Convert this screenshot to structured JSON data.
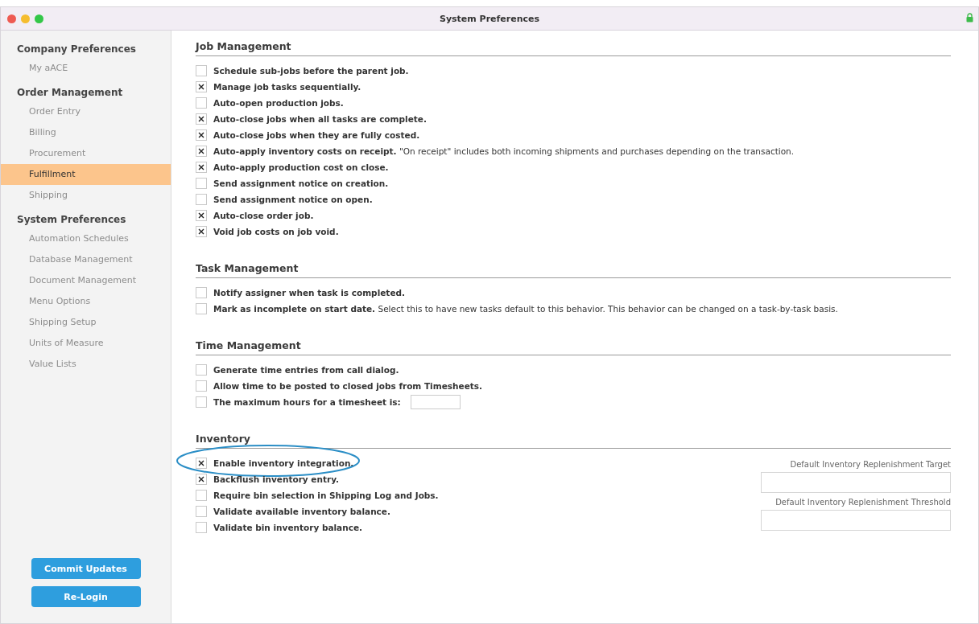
{
  "window": {
    "title": "System Preferences"
  },
  "sidebar": {
    "groups": [
      {
        "heading": "Company Preferences",
        "items": [
          {
            "label": "My aACE",
            "selected": false
          }
        ]
      },
      {
        "heading": "Order Management",
        "items": [
          {
            "label": "Order Entry",
            "selected": false
          },
          {
            "label": "Billing",
            "selected": false
          },
          {
            "label": "Procurement",
            "selected": false
          },
          {
            "label": "Fulfillment",
            "selected": true
          },
          {
            "label": "Shipping",
            "selected": false
          }
        ]
      },
      {
        "heading": "System Preferences",
        "items": [
          {
            "label": "Automation Schedules",
            "selected": false
          },
          {
            "label": "Database Management",
            "selected": false
          },
          {
            "label": "Document Management",
            "selected": false
          },
          {
            "label": "Menu Options",
            "selected": false
          },
          {
            "label": "Shipping Setup",
            "selected": false
          },
          {
            "label": "Units of Measure",
            "selected": false
          },
          {
            "label": "Value Lists",
            "selected": false
          }
        ]
      }
    ],
    "buttons": [
      "Commit Updates",
      "Re-Login"
    ]
  },
  "sections": [
    {
      "title": "Job Management",
      "items": [
        {
          "kind": "checkbox",
          "label": "Schedule sub-jobs before the parent job.",
          "checked": false
        },
        {
          "kind": "checkbox",
          "label": "Manage job tasks sequentially.",
          "checked": true
        },
        {
          "kind": "checkbox",
          "label": "Auto-open production jobs.",
          "checked": false
        },
        {
          "kind": "checkbox",
          "label": "Auto-close jobs when all tasks are complete.",
          "checked": true
        },
        {
          "kind": "checkbox",
          "label": "Auto-close jobs when they are fully costed.",
          "checked": true
        },
        {
          "kind": "checkbox",
          "label": "Auto-apply inventory costs on receipt.",
          "note": "\"On receipt\" includes both incoming shipments and purchases depending on the transaction.",
          "checked": true
        },
        {
          "kind": "checkbox",
          "label": "Auto-apply production cost on close.",
          "checked": true
        },
        {
          "kind": "checkbox",
          "label": "Send assignment notice on creation.",
          "checked": false
        },
        {
          "kind": "checkbox",
          "label": "Send assignment notice on open.",
          "checked": false
        },
        {
          "kind": "checkbox",
          "label": "Auto-close order job.",
          "checked": true
        },
        {
          "kind": "checkbox",
          "label": "Void job costs on job void.",
          "checked": true
        }
      ]
    },
    {
      "title": "Task Management",
      "items": [
        {
          "kind": "checkbox",
          "label": "Notify assigner when task is completed.",
          "checked": false
        },
        {
          "kind": "checkbox",
          "label": "Mark as incomplete on start date.",
          "note": "Select this to have new tasks default to this behavior. This behavior can be changed on a task-by-task basis.",
          "checked": false
        }
      ]
    },
    {
      "title": "Time Management",
      "items": [
        {
          "kind": "checkbox",
          "label": "Generate time entries from call dialog.",
          "checked": false
        },
        {
          "kind": "checkbox",
          "label": "Allow time to be posted to closed jobs from Timesheets.",
          "checked": false
        },
        {
          "kind": "checkbox_input",
          "label": "The maximum hours for a timesheet is:",
          "checked": false
        }
      ]
    },
    {
      "title": "Inventory",
      "items": [
        {
          "kind": "checkbox",
          "label": "Enable inventory integration.",
          "checked": true,
          "highlighted": true
        },
        {
          "kind": "checkbox",
          "label": "Backflush inventory entry.",
          "checked": true
        },
        {
          "kind": "checkbox",
          "label": "Require bin selection in Shipping Log and Jobs.",
          "checked": false
        },
        {
          "kind": "checkbox",
          "label": "Validate available inventory balance.",
          "checked": false
        },
        {
          "kind": "checkbox",
          "label": "Validate bin inventory balance.",
          "checked": false
        }
      ],
      "side_fields": [
        {
          "label": "Default Inventory Replenishment Target"
        },
        {
          "label": "Default Inventory Replenishment Threshold"
        }
      ]
    }
  ]
}
